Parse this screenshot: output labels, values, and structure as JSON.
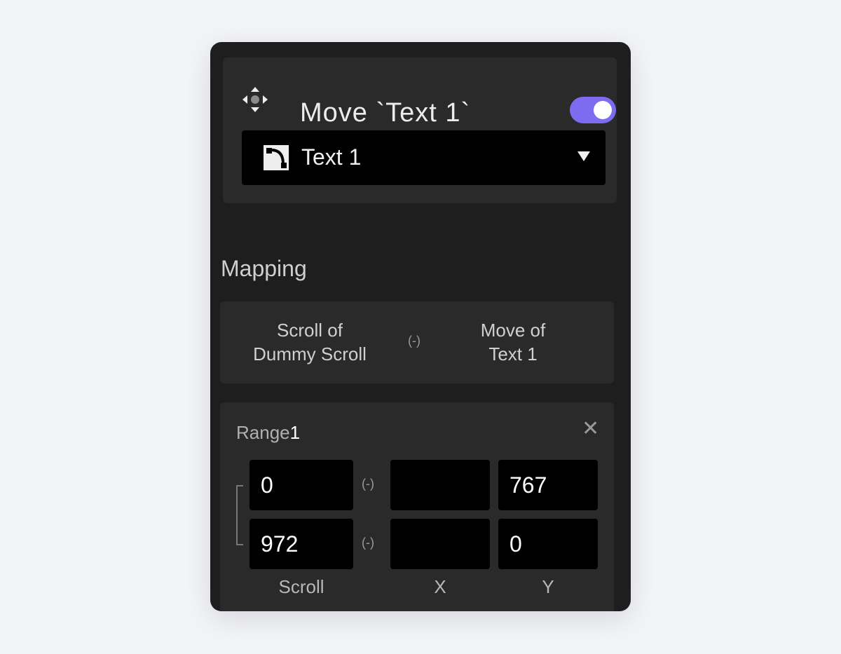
{
  "header": {
    "title": "Move `Text 1`",
    "enabled": true,
    "toggle_color": "#7d6cf0",
    "icon": "move-arrows-icon"
  },
  "target_select": {
    "value": "Text 1",
    "icon": "shape-path-icon"
  },
  "mapping": {
    "label": "Mapping",
    "source_line1": "Scroll of",
    "source_line2": "Dummy Scroll",
    "target_line1": "Move of",
    "target_line2": "Text 1",
    "link_icon": "link-icon"
  },
  "range": {
    "label": "Range",
    "index": "1",
    "rows": [
      {
        "scroll": "0",
        "x": "",
        "y": "767"
      },
      {
        "scroll": "972",
        "x": "",
        "y": "0"
      }
    ],
    "columns": [
      "Scroll",
      "X",
      "Y"
    ]
  }
}
